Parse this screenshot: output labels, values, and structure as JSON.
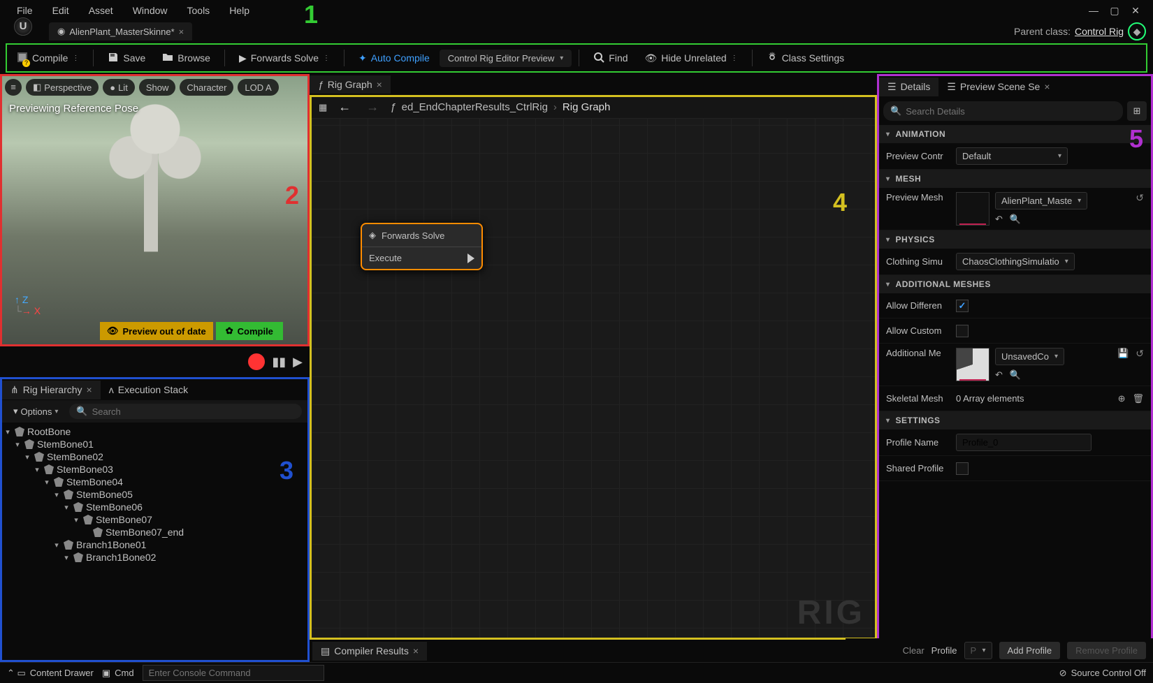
{
  "menu": [
    "File",
    "Edit",
    "Asset",
    "Window",
    "Tools",
    "Help"
  ],
  "annotations": {
    "n1": "1",
    "n2": "2",
    "n3": "3",
    "n4": "4",
    "n5": "5"
  },
  "doc_tab": {
    "title": "AlienPlant_MasterSkinne*"
  },
  "parent_class": {
    "label": "Parent class:",
    "value": "Control Rig"
  },
  "toolbar": {
    "compile": "Compile",
    "save": "Save",
    "browse": "Browse",
    "forwards_solve": "Forwards Solve",
    "auto_compile": "Auto Compile",
    "preview_mode": "Control Rig Editor Preview",
    "find": "Find",
    "hide_unrelated": "Hide Unrelated",
    "class_settings": "Class Settings"
  },
  "viewport": {
    "chips": {
      "perspective": "Perspective",
      "lit": "Lit",
      "show": "Show",
      "character": "Character",
      "lod": "LOD A"
    },
    "overlay": "Previewing Reference Pose",
    "warning": "Preview out of date",
    "compile": "Compile"
  },
  "hierarchy": {
    "tabs": {
      "rig": "Rig Hierarchy",
      "exec": "Execution Stack"
    },
    "options": "Options",
    "search_ph": "Search",
    "bones": [
      "RootBone",
      "StemBone01",
      "StemBone02",
      "StemBone03",
      "StemBone04",
      "StemBone05",
      "StemBone06",
      "StemBone07",
      "StemBone07_end",
      "Branch1Bone01",
      "Branch1Bone02"
    ]
  },
  "graph": {
    "tab": "Rig Graph",
    "crumb1": "ed_EndChapterResults_CtrlRig",
    "crumb2": "Rig Graph",
    "node_title": "Forwards Solve",
    "node_exec": "Execute",
    "watermark": "RIG",
    "compiler_tab": "Compiler Results"
  },
  "details": {
    "tabs": {
      "details": "Details",
      "preview": "Preview Scene Se"
    },
    "search_ph": "Search Details",
    "cats": {
      "anim": "ANIMATION",
      "mesh": "MESH",
      "physics": "PHYSICS",
      "add_meshes": "ADDITIONAL MESHES",
      "settings": "SETTINGS"
    },
    "props": {
      "preview_ctrl_l": "Preview Contr",
      "preview_ctrl_v": "Default",
      "preview_mesh_l": "Preview Mesh",
      "preview_mesh_v": "AlienPlant_Maste",
      "clothing_l": "Clothing Simu",
      "clothing_v": "ChaosClothingSimulatio",
      "allow_diff_l": "Allow Differen",
      "allow_custom_l": "Allow Custom",
      "add_me_l": "Additional Me",
      "add_me_v": "UnsavedCo",
      "skel_mesh_l": "Skeletal Mesh",
      "skel_mesh_v": "0 Array elements",
      "profile_name_l": "Profile Name",
      "profile_name_v": "Profile_0",
      "shared_profile_l": "Shared Profile"
    }
  },
  "profile_bar": {
    "clear": "Clear",
    "profile": "Profile",
    "add": "Add Profile",
    "remove": "Remove Profile"
  },
  "status": {
    "drawer": "Content Drawer",
    "cmd": "Cmd",
    "cmd_ph": "Enter Console Command",
    "src": "Source Control Off"
  }
}
